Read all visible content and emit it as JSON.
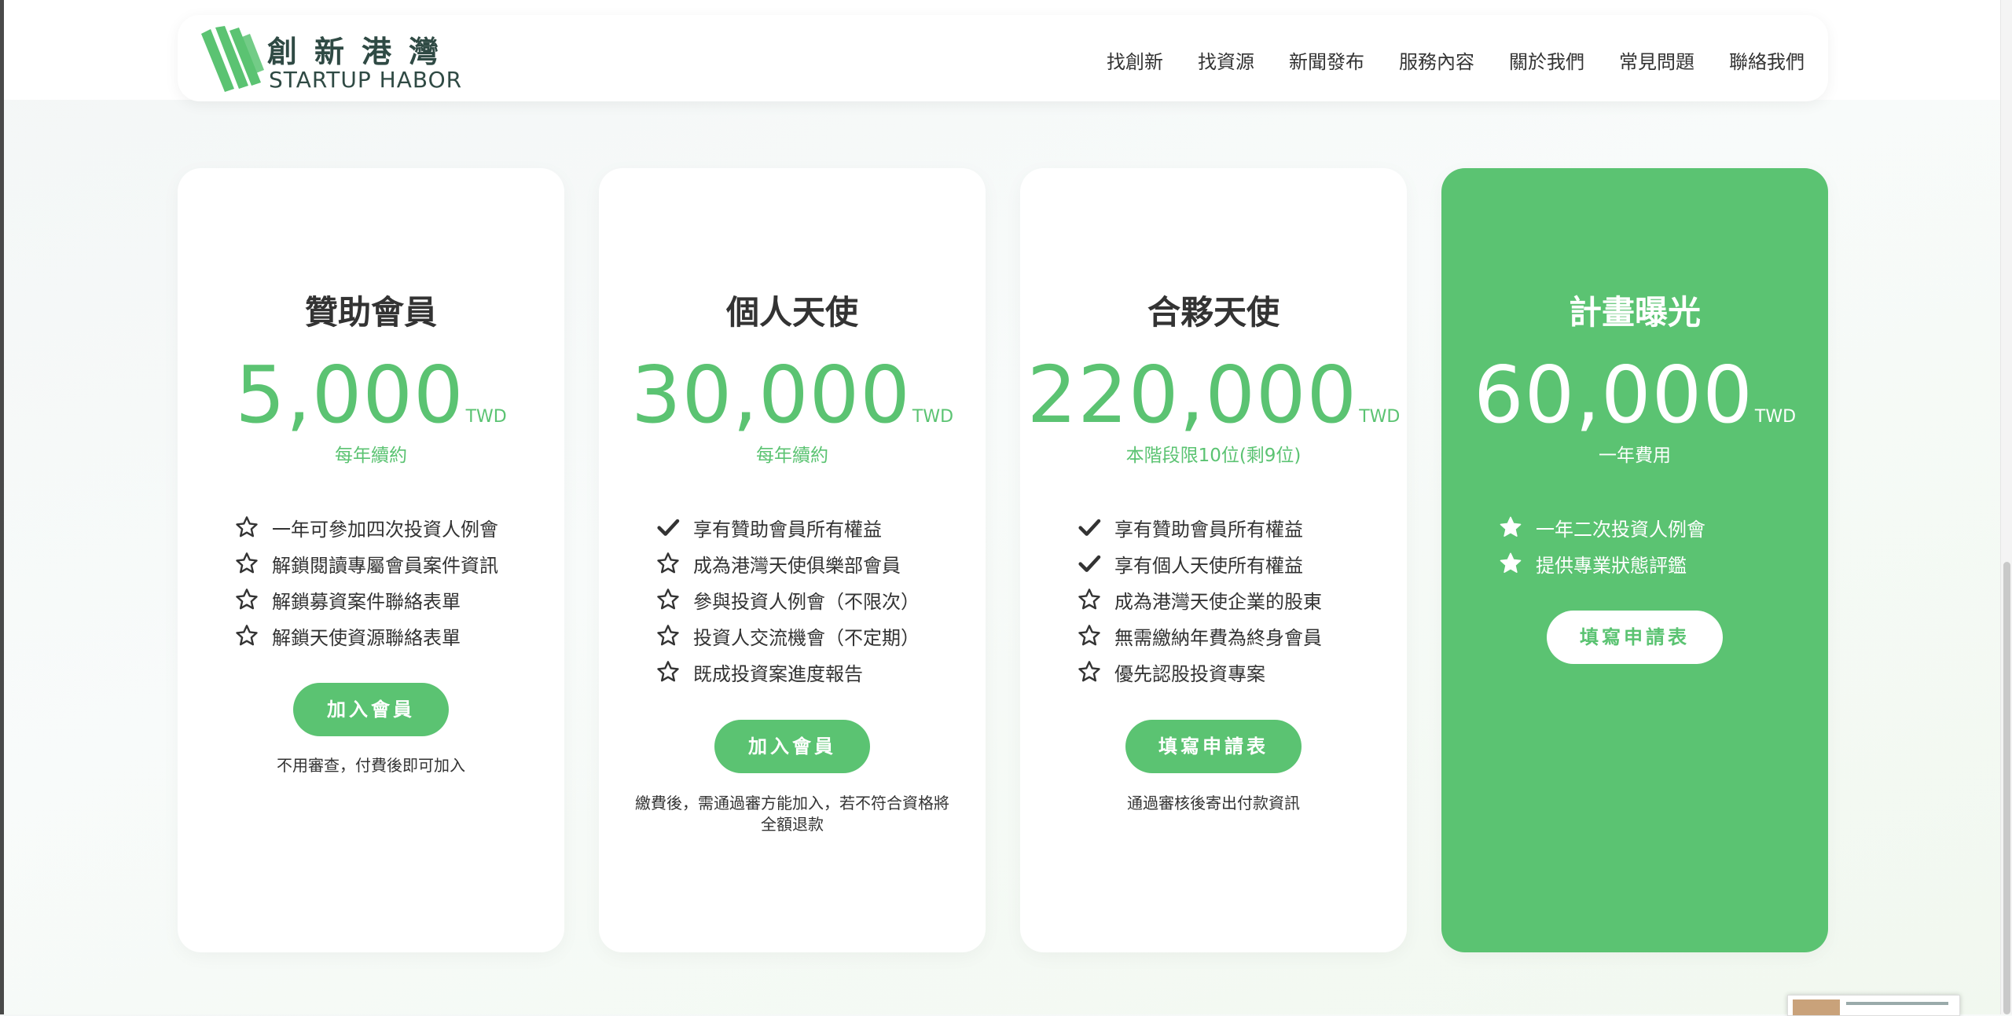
{
  "brand": {
    "name_cn": "創新港灣",
    "name_en": "STARTUP HABOR",
    "color": "#5bc372"
  },
  "nav": [
    "找創新",
    "找資源",
    "新聞發布",
    "服務內容",
    "關於我們",
    "常見問題",
    "聯絡我們"
  ],
  "plans": [
    {
      "title": "贊助會員",
      "price": "5,000",
      "currency": "TWD",
      "subtitle": "每年續約",
      "features": [
        {
          "icon": "star-outline-icon",
          "text": "一年可參加四次投資人例會"
        },
        {
          "icon": "star-outline-icon",
          "text": "解鎖閱讀專屬會員案件資訊"
        },
        {
          "icon": "star-outline-icon",
          "text": "解鎖募資案件聯絡表單"
        },
        {
          "icon": "star-outline-icon",
          "text": "解鎖天使資源聯絡表單"
        }
      ],
      "button": "加入會員",
      "note": "不用審查，付費後即可加入"
    },
    {
      "title": "個人天使",
      "price": "30,000",
      "currency": "TWD",
      "subtitle": "每年續約",
      "features": [
        {
          "icon": "check-icon",
          "text": "享有贊助會員所有權益"
        },
        {
          "icon": "star-outline-icon",
          "text": "成為港灣天使俱樂部會員"
        },
        {
          "icon": "star-outline-icon",
          "text": "參與投資人例會（不限次）"
        },
        {
          "icon": "star-outline-icon",
          "text": "投資人交流機會（不定期）"
        },
        {
          "icon": "star-outline-icon",
          "text": "既成投資案進度報告"
        }
      ],
      "button": "加入會員",
      "note": "繳費後，需通過審方能加入，若不符合資格將全額退款"
    },
    {
      "title": "合夥天使",
      "price": "220,000",
      "currency": "TWD",
      "subtitle": "本階段限10位(剩9位)",
      "features": [
        {
          "icon": "check-icon",
          "text": "享有贊助會員所有權益"
        },
        {
          "icon": "check-icon",
          "text": "享有個人天使所有權益"
        },
        {
          "icon": "star-outline-icon",
          "text": "成為港灣天使企業的股東"
        },
        {
          "icon": "star-outline-icon",
          "text": "無需繳納年費為終身會員"
        },
        {
          "icon": "star-outline-icon",
          "text": "優先認股投資專案"
        }
      ],
      "button": "填寫申請表",
      "note": "通過審核後寄出付款資訊"
    },
    {
      "title": "計畫曝光",
      "price": "60,000",
      "currency": "TWD",
      "subtitle": "一年費用",
      "highlight": true,
      "features": [
        {
          "icon": "star-filled-icon",
          "text": "一年二次投資人例會"
        },
        {
          "icon": "star-filled-icon",
          "text": "提供專業狀態評鑑"
        }
      ],
      "button": "填寫申請表",
      "note": ""
    }
  ]
}
